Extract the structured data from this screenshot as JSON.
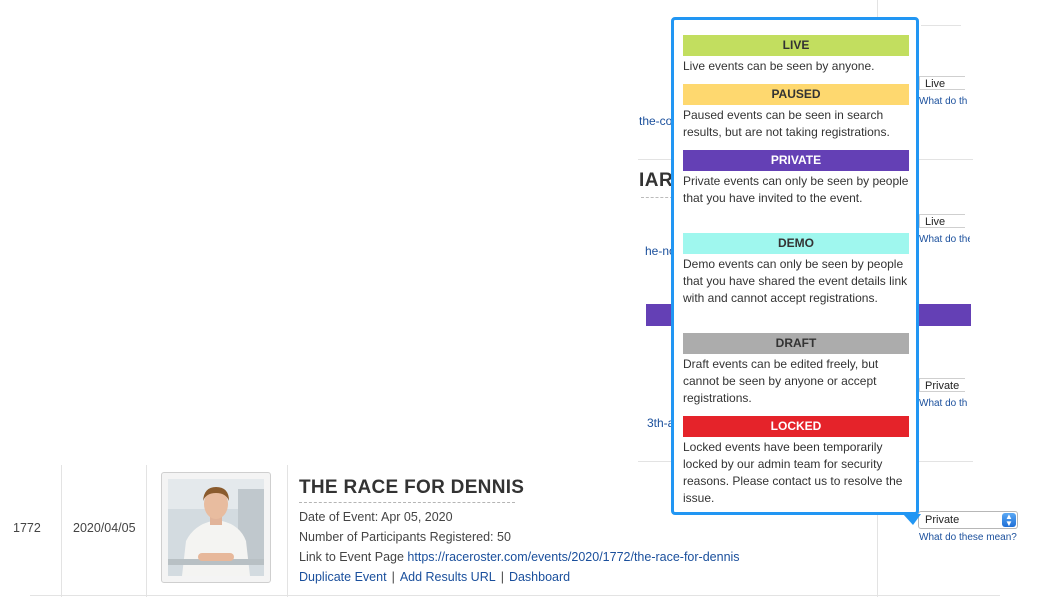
{
  "background_rows": {
    "status_values": [
      "Live",
      "Live",
      "Private"
    ],
    "status_help_fragment": "What do th",
    "status_help_fragment_alt": "What do the",
    "slug_fragments": [
      "the-co",
      "he-no",
      "3th-a"
    ],
    "title_fragment": "IAR"
  },
  "event_row": {
    "id": "1772",
    "date_created": "2020/04/05",
    "title": "THE RACE FOR DENNIS",
    "date_label": "Date of Event: Apr 05, 2020",
    "participants_label": "Number of Participants Registered: 50",
    "link_label": "Link to Event Page",
    "link_url": "https://raceroster.com/events/2020/1772/the-race-for-dennis",
    "actions": [
      "Duplicate Event",
      "Add Results URL",
      "Dashboard"
    ],
    "action_separator": "|",
    "status_selected": "Private",
    "status_help_link": "What do these mean?"
  },
  "status_popover": {
    "items": [
      {
        "label": "LIVE",
        "color": "#c2de5f",
        "text_color": "#333333",
        "description": "Live events can be seen by anyone."
      },
      {
        "label": "PAUSED",
        "color": "#fed86f",
        "text_color": "#333333",
        "description": "Paused events can be seen in search results, but are not taking registrations."
      },
      {
        "label": "PRIVATE",
        "color": "#6440b5",
        "text_color": "#ffffff",
        "description": "Private events can only be seen by people that you have invited to the event."
      },
      {
        "label": "DEMO",
        "color": "#9ff7ee",
        "text_color": "#333333",
        "description": "Demo events can only be seen by people that you have shared the event details link with and cannot accept registrations."
      },
      {
        "label": "DRAFT",
        "color": "#acacac",
        "text_color": "#333333",
        "description": "Draft events can be edited freely, but cannot be seen by anyone or accept registrations."
      },
      {
        "label": "LOCKED",
        "color": "#e5232a",
        "text_color": "#ffffff",
        "description": "Locked events have been temporarily locked by our admin team for security reasons. Please contact us to resolve the issue."
      }
    ]
  },
  "colors": {
    "popover_border": "#2196f3",
    "link": "#1a4f9c",
    "background_purple_bar": "#6440b5"
  }
}
